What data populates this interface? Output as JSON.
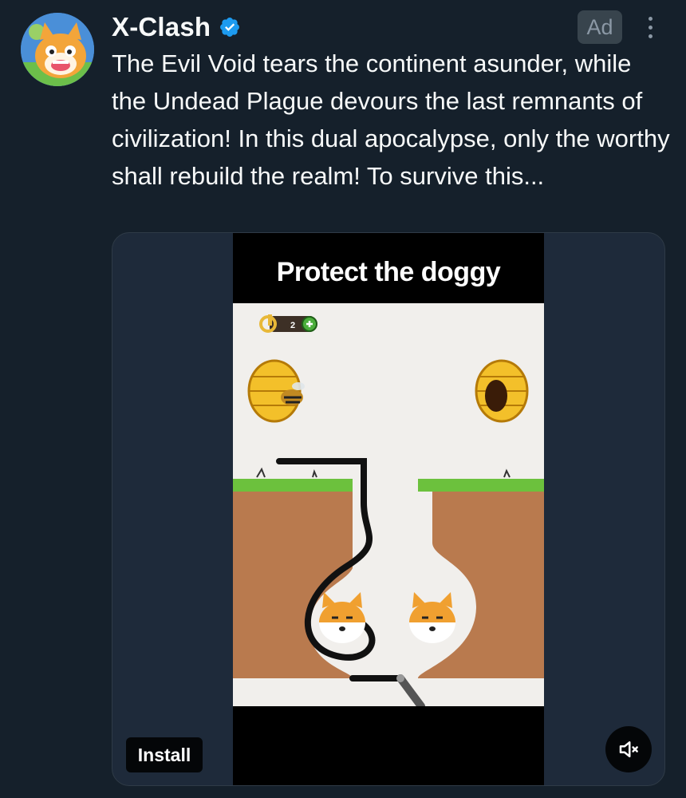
{
  "post": {
    "author": "X-Clash",
    "verified": true,
    "ad_label": "Ad",
    "text": "The Evil Void tears the continent asunder, while the Undead Plague devours the last remnants of civilization! In this dual apocalypse, only the worthy shall rebuild the realm! To survive this..."
  },
  "media": {
    "video_title": "Protect the doggy",
    "key_count": "2",
    "install_label": "Install"
  },
  "icons": {
    "verified": "verified-badge-icon",
    "more": "more-options-icon",
    "mute": "speaker-muted-icon",
    "key": "key-icon",
    "add": "plus-icon"
  },
  "colors": {
    "background": "#15202b",
    "verified": "#1d9bf0",
    "text_primary": "#f7f9f9",
    "text_secondary": "#8b98a5"
  }
}
